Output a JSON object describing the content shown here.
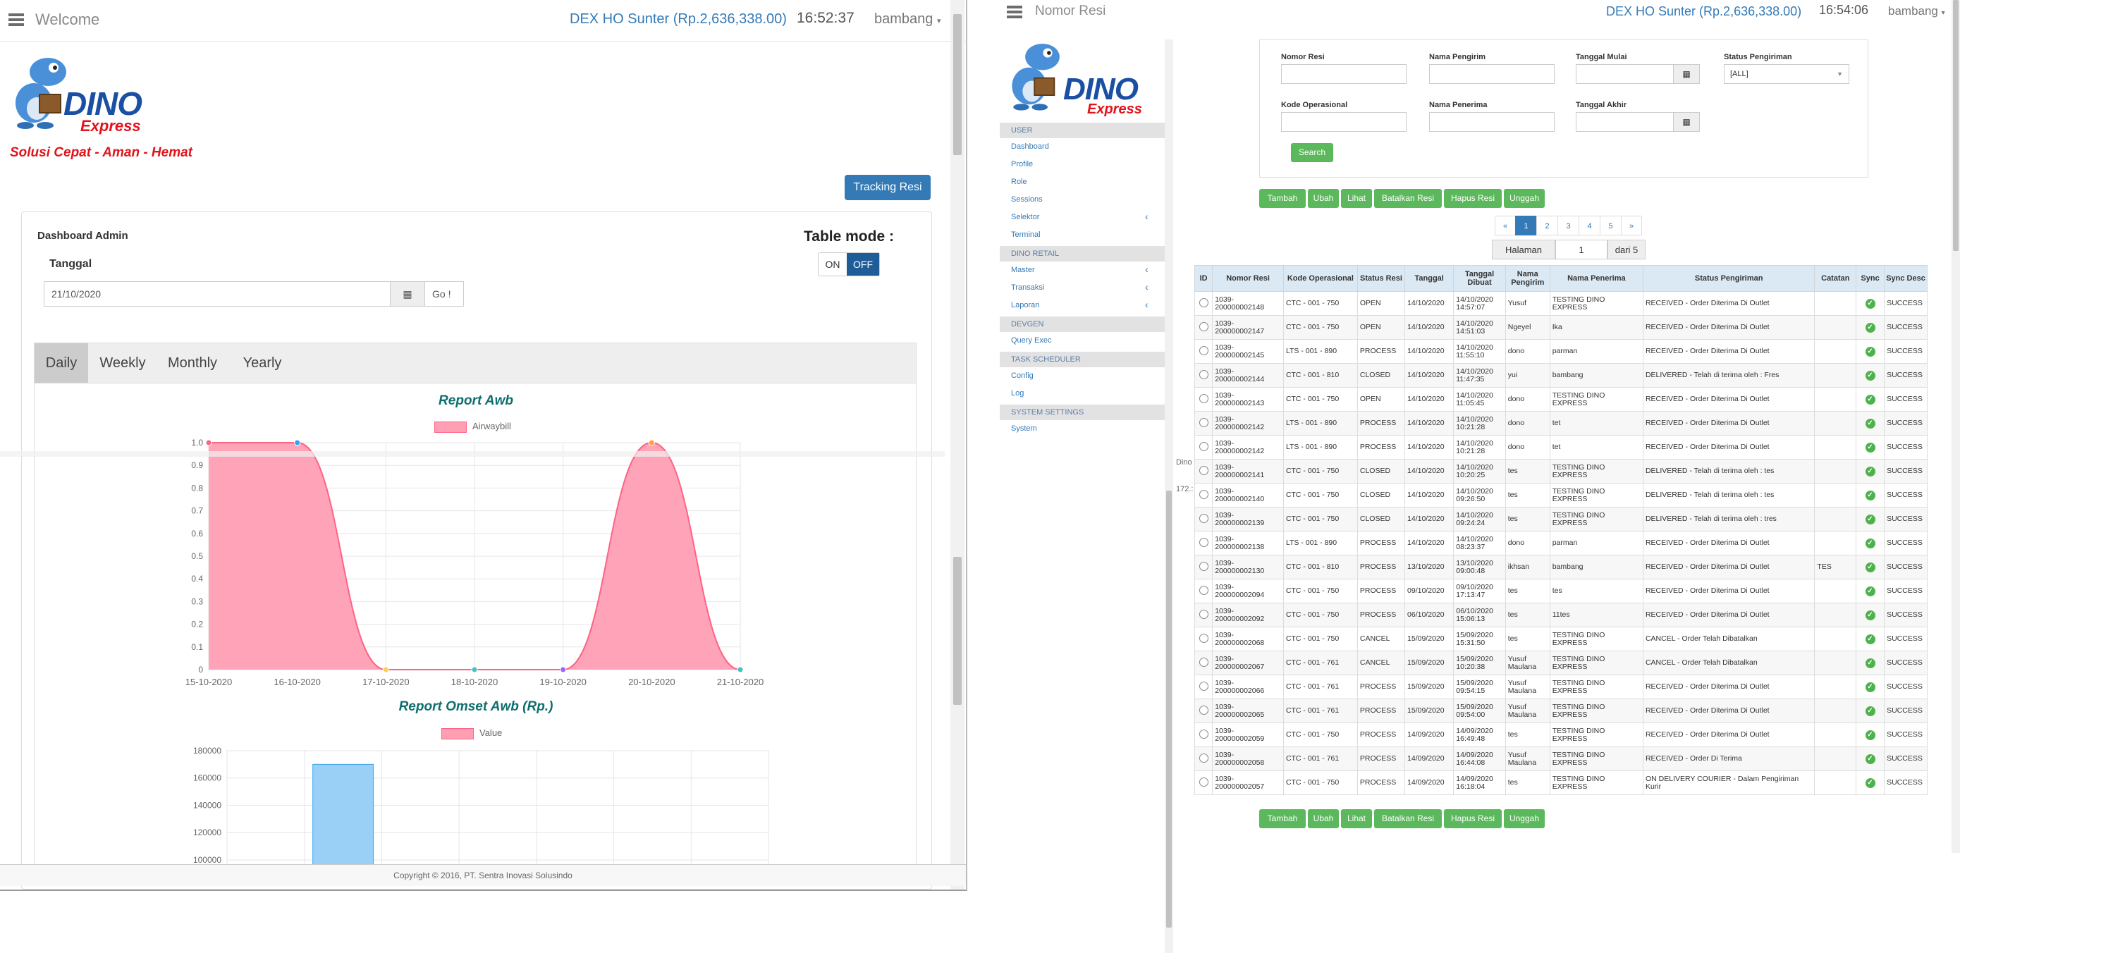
{
  "left_window": {
    "title": "Welcome",
    "balance": "DEX HO Sunter (Rp.2,636,338.00)",
    "clock": "16:52:37",
    "user": "bambang",
    "logo_word": "DINO",
    "logo_sub": "Express",
    "tagline": "Solusi Cepat - Aman - Hemat",
    "tracking_button": "Tracking Resi",
    "dashboard_title": "Dashboard Admin",
    "date_label": "Tanggal",
    "date_value": "21/10/2020",
    "go_button": "Go !",
    "table_mode_label": "Table mode :",
    "toggle_on": "ON",
    "toggle_off": "OFF",
    "tabs": [
      "Daily",
      "Weekly",
      "Monthly",
      "Yearly"
    ],
    "active_tab": "Daily",
    "footer": "Copyright © 2016, PT. Sentra Inovasi Solusindo"
  },
  "chart_data": [
    {
      "type": "area",
      "title": "Report Awb",
      "series": [
        {
          "name": "Airwaybill",
          "values": [
            1,
            1,
            0,
            0,
            0,
            1,
            0
          ]
        }
      ],
      "categories": [
        "15-10-2020",
        "16-10-2020",
        "17-10-2020",
        "18-10-2020",
        "19-10-2020",
        "20-10-2020",
        "21-10-2020"
      ],
      "yticks": [
        "0",
        "0.1",
        "0.2",
        "0.3",
        "0.4",
        "0.5",
        "0.6",
        "0.7",
        "0.8",
        "0.9",
        "1.0"
      ],
      "ylim": [
        0,
        1
      ],
      "color": "#ff6384",
      "fill": "#ff9fb4"
    },
    {
      "type": "bar",
      "title": "Report Omset Awb (Rp.)",
      "series": [
        {
          "name": "Value",
          "values": [
            null,
            170000,
            null,
            null,
            null,
            null,
            null
          ]
        }
      ],
      "yticks": [
        "100000",
        "120000",
        "140000",
        "160000",
        "180000"
      ],
      "ylim": [
        100000,
        180000
      ],
      "bar_color": "#9ad0f5",
      "bar_border": "#36a2eb"
    }
  ],
  "right_window": {
    "title": "Nomor Resi",
    "balance": "DEX HO Sunter (Rp.2,636,338.00)",
    "clock": "16:54:06",
    "user": "bambang",
    "logo_word": "DINO",
    "logo_sub": "Express",
    "sidebar": [
      {
        "type": "section",
        "label": "USER"
      },
      {
        "type": "item",
        "label": "Dashboard"
      },
      {
        "type": "item",
        "label": "Profile"
      },
      {
        "type": "item",
        "label": "Role"
      },
      {
        "type": "item",
        "label": "Sessions"
      },
      {
        "type": "item",
        "label": "Selektor",
        "arrow": true
      },
      {
        "type": "item",
        "label": "Terminal"
      },
      {
        "type": "section",
        "label": "DINO RETAIL"
      },
      {
        "type": "item",
        "label": "Master",
        "arrow": true
      },
      {
        "type": "item",
        "label": "Transaksi",
        "arrow": true
      },
      {
        "type": "item",
        "label": "Laporan",
        "arrow": true
      },
      {
        "type": "section",
        "label": "DEVGEN"
      },
      {
        "type": "item",
        "label": "Query Exec"
      },
      {
        "type": "section",
        "label": "TASK SCHEDULER"
      },
      {
        "type": "item",
        "label": "Config"
      },
      {
        "type": "item",
        "label": "Log"
      },
      {
        "type": "section",
        "label": "SYSTEM SETTINGS"
      },
      {
        "type": "item",
        "label": "System"
      }
    ],
    "filters": {
      "nomor_resi": "Nomor Resi",
      "nama_pengirim": "Nama Pengirim",
      "tanggal_mulai": "Tanggal Mulai",
      "status_pengiriman": "Status Pengiriman",
      "status_value": "[ALL]",
      "kode_operasional": "Kode Operasional",
      "nama_penerima": "Nama Penerima",
      "tanggal_akhir": "Tanggal Akhir",
      "search_button": "Search"
    },
    "actions": [
      "Tambah",
      "Ubah",
      "Lihat",
      "Batalkan Resi",
      "Hapus Resi",
      "Unggah"
    ],
    "pagination": {
      "prev": "«",
      "pages": [
        "1",
        "2",
        "3",
        "4",
        "5"
      ],
      "next": "»",
      "active": "1"
    },
    "page_of": {
      "label": "Halaman",
      "value": "1",
      "total": "dari 5"
    },
    "table_headers": [
      "ID",
      "Nomor Resi",
      "Kode Operasional",
      "Status Resi",
      "Tanggal",
      "Tanggal Dibuat",
      "Nama Pengirim",
      "Nama Penerima",
      "Status Pengiriman",
      "Catatan",
      "Sync",
      "Sync Desc"
    ],
    "rows": [
      [
        "1039-200000002148",
        "CTC - 001 - 750",
        "OPEN",
        "14/10/2020",
        "14/10/2020 14:57:07",
        "Yusuf",
        "TESTING DINO EXPRESS",
        "RECEIVED - Order Diterima Di Outlet",
        "",
        "SUCCESS"
      ],
      [
        "1039-200000002147",
        "CTC - 001 - 750",
        "OPEN",
        "14/10/2020",
        "14/10/2020 14:51:03",
        "Ngeyel",
        "Ika",
        "RECEIVED - Order Diterima Di Outlet",
        "",
        "SUCCESS"
      ],
      [
        "1039-200000002145",
        "LTS - 001 - 890",
        "PROCESS",
        "14/10/2020",
        "14/10/2020 11:55:10",
        "dono",
        "parman",
        "RECEIVED - Order Diterima Di Outlet",
        "",
        "SUCCESS"
      ],
      [
        "1039-200000002144",
        "CTC - 001 - 810",
        "CLOSED",
        "14/10/2020",
        "14/10/2020 11:47:35",
        "yui",
        "bambang",
        "DELIVERED - Telah di terima oleh : Fres",
        "",
        "SUCCESS"
      ],
      [
        "1039-200000002143",
        "CTC - 001 - 750",
        "OPEN",
        "14/10/2020",
        "14/10/2020 11:05:45",
        "dono",
        "TESTING DINO EXPRESS",
        "RECEIVED - Order Diterima Di Outlet",
        "",
        "SUCCESS"
      ],
      [
        "1039-200000002142",
        "LTS - 001 - 890",
        "PROCESS",
        "14/10/2020",
        "14/10/2020 10:21:28",
        "dono",
        "tet",
        "RECEIVED - Order Diterima Di Outlet",
        "",
        "SUCCESS"
      ],
      [
        "1039-200000002142",
        "LTS - 001 - 890",
        "PROCESS",
        "14/10/2020",
        "14/10/2020 10:21:28",
        "dono",
        "tet",
        "RECEIVED - Order Diterima Di Outlet",
        "",
        "SUCCESS"
      ],
      [
        "1039-200000002141",
        "CTC - 001 - 750",
        "CLOSED",
        "14/10/2020",
        "14/10/2020 10:20:25",
        "tes",
        "TESTING DINO EXPRESS",
        "DELIVERED - Telah di terima oleh : tes",
        "",
        "SUCCESS"
      ],
      [
        "1039-200000002140",
        "CTC - 001 - 750",
        "CLOSED",
        "14/10/2020",
        "14/10/2020 09:26:50",
        "tes",
        "TESTING DINO EXPRESS",
        "DELIVERED - Telah di terima oleh : tes",
        "",
        "SUCCESS"
      ],
      [
        "1039-200000002139",
        "CTC - 001 - 750",
        "CLOSED",
        "14/10/2020",
        "14/10/2020 09:24:24",
        "tes",
        "TESTING DINO EXPRESS",
        "DELIVERED - Telah di terima oleh : tres",
        "",
        "SUCCESS"
      ],
      [
        "1039-200000002138",
        "LTS - 001 - 890",
        "PROCESS",
        "14/10/2020",
        "14/10/2020 08:23:37",
        "dono",
        "parman",
        "RECEIVED - Order Diterima Di Outlet",
        "",
        "SUCCESS"
      ],
      [
        "1039-200000002130",
        "CTC - 001 - 810",
        "PROCESS",
        "13/10/2020",
        "13/10/2020 09:00:48",
        "ikhsan",
        "bambang",
        "RECEIVED - Order Diterima Di Outlet",
        "TES",
        "SUCCESS"
      ],
      [
        "1039-200000002094",
        "CTC - 001 - 750",
        "PROCESS",
        "09/10/2020",
        "09/10/2020 17:13:47",
        "tes",
        "tes",
        "RECEIVED - Order Diterima Di Outlet",
        "",
        "SUCCESS"
      ],
      [
        "1039-200000002092",
        "CTC - 001 - 750",
        "PROCESS",
        "06/10/2020",
        "06/10/2020 15:06:13",
        "tes",
        "11tes",
        "RECEIVED - Order Diterima Di Outlet",
        "",
        "SUCCESS"
      ],
      [
        "1039-200000002068",
        "CTC - 001 - 750",
        "CANCEL",
        "15/09/2020",
        "15/09/2020 15:31:50",
        "tes",
        "TESTING DINO EXPRESS",
        "CANCEL - Order Telah Dibatalkan",
        "",
        "SUCCESS"
      ],
      [
        "1039-200000002067",
        "CTC - 001 - 761",
        "CANCEL",
        "15/09/2020",
        "15/09/2020 10:20:38",
        "Yusuf Maulana",
        "TESTING DINO EXPRESS",
        "CANCEL - Order Telah Dibatalkan",
        "",
        "SUCCESS"
      ],
      [
        "1039-200000002066",
        "CTC - 001 - 761",
        "PROCESS",
        "15/09/2020",
        "15/09/2020 09:54:15",
        "Yusuf Maulana",
        "TESTING DINO EXPRESS",
        "RECEIVED - Order Diterima Di Outlet",
        "",
        "SUCCESS"
      ],
      [
        "1039-200000002065",
        "CTC - 001 - 761",
        "PROCESS",
        "15/09/2020",
        "15/09/2020 09:54:00",
        "Yusuf Maulana",
        "TESTING DINO EXPRESS",
        "RECEIVED - Order Diterima Di Outlet",
        "",
        "SUCCESS"
      ],
      [
        "1039-200000002059",
        "CTC - 001 - 750",
        "PROCESS",
        "14/09/2020",
        "14/09/2020 16:49:48",
        "tes",
        "TESTING DINO EXPRESS",
        "RECEIVED - Order Diterima Di Outlet",
        "",
        "SUCCESS"
      ],
      [
        "1039-200000002058",
        "CTC - 001 - 761",
        "PROCESS",
        "14/09/2020",
        "14/09/2020 16:44:08",
        "Yusuf Maulana",
        "TESTING DINO EXPRESS",
        "RECEIVED - Order Di Terima",
        "",
        "SUCCESS"
      ],
      [
        "1039-200000002057",
        "CTC - 001 - 750",
        "PROCESS",
        "14/09/2020",
        "14/09/2020 16:18:04",
        "tes",
        "TESTING DINO EXPRESS",
        "ON DELIVERY COURIER - Dalam Pengiriman Kurir",
        "",
        "SUCCESS"
      ]
    ]
  }
}
